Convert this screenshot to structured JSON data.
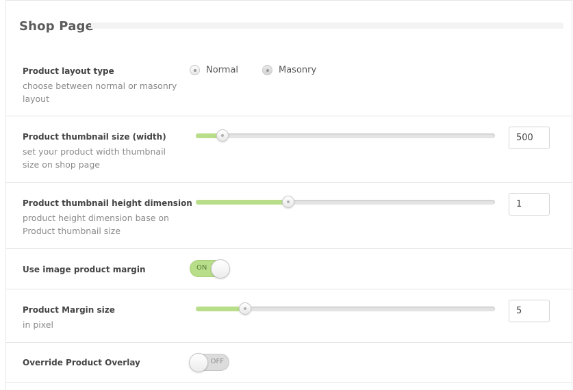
{
  "section": {
    "title": "Shop Page"
  },
  "rows": {
    "layout": {
      "label": "Product layout type",
      "desc": "choose between normal or masonry layout",
      "options": [
        "Normal",
        "Masonry"
      ],
      "selected": "Normal"
    },
    "thumb_width": {
      "label": "Product thumbnail size (width)",
      "desc": "set your product width thumbnail size on shop page",
      "value": "500",
      "level": 0.09
    },
    "thumb_height": {
      "label": "Product thumbnail height dimension",
      "desc": "product height dimension base on Product thumbnail size",
      "value": "1",
      "level": 0.31
    },
    "image_margin": {
      "label": "Use image product margin",
      "state": "ON"
    },
    "margin_size": {
      "label": "Product Margin size",
      "desc": "in pixel",
      "value": "5",
      "level": 0.165
    },
    "overlay": {
      "label": "Override Product Overlay",
      "state": "OFF"
    }
  },
  "colors": {
    "accent": "#b8de8a",
    "track": "#e4e4e4"
  }
}
